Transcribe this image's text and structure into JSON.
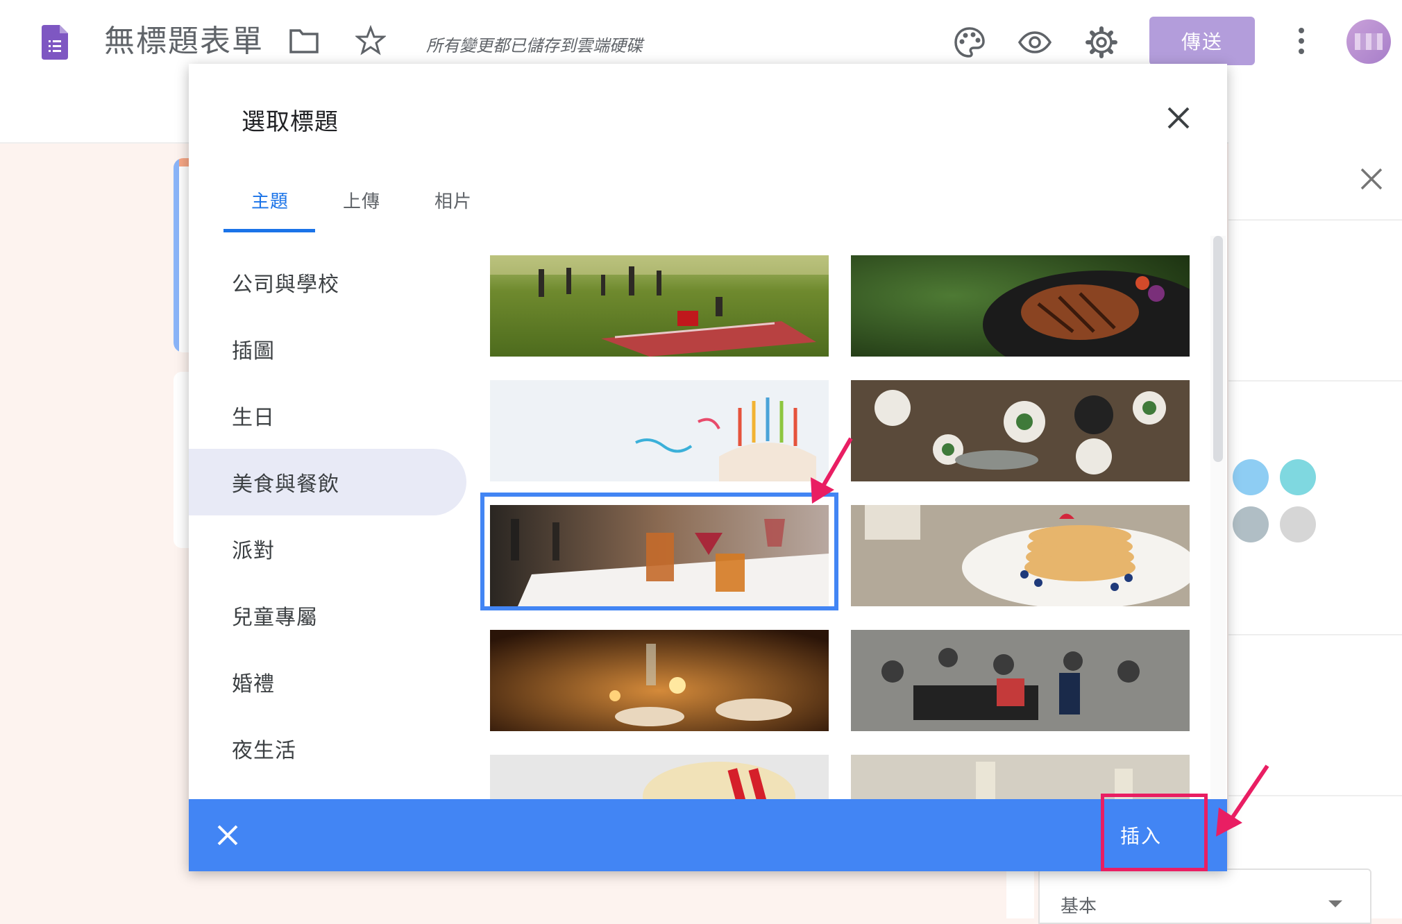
{
  "app": {
    "title": "無標題表單",
    "save_status": "所有變更都已儲存到雲端硬碟",
    "send_label": "傳送",
    "icons": [
      "forms-logo-icon",
      "folder-icon",
      "star-icon",
      "palette-icon",
      "eye-icon",
      "gear-icon",
      "more-vert-icon"
    ]
  },
  "dialog": {
    "title": "選取標題",
    "tabs": [
      {
        "label": "主題",
        "active": true
      },
      {
        "label": "上傳",
        "active": false
      },
      {
        "label": "相片",
        "active": false
      }
    ],
    "categories": [
      {
        "label": "公司與學校",
        "selected": false
      },
      {
        "label": "插圖",
        "selected": false
      },
      {
        "label": "生日",
        "selected": false
      },
      {
        "label": "美食與餐飲",
        "selected": true
      },
      {
        "label": "派對",
        "selected": false
      },
      {
        "label": "兒童專屬",
        "selected": false
      },
      {
        "label": "婚禮",
        "selected": false
      },
      {
        "label": "夜生活",
        "selected": false
      }
    ],
    "images": [
      {
        "name": "picnic",
        "selected": false
      },
      {
        "name": "bbq-steak",
        "selected": false
      },
      {
        "name": "birthday-cake",
        "selected": false
      },
      {
        "name": "dinner-table",
        "selected": false
      },
      {
        "name": "cocktails",
        "selected": true
      },
      {
        "name": "pancakes",
        "selected": false
      },
      {
        "name": "candlelight-dinner",
        "selected": false
      },
      {
        "name": "party-crowd",
        "selected": false
      },
      {
        "name": "popcorn",
        "selected": false
      },
      {
        "name": "champagne",
        "selected": false
      }
    ],
    "insert_label": "插入",
    "accent_color": "#4285f4",
    "highlight_color": "#e91e63"
  },
  "side_panel": {
    "swatch_colors": [
      "#8ecdf3",
      "#7fd8e0",
      "#b0bec5",
      "#d6d6d6"
    ],
    "font_select_value": "基本"
  }
}
